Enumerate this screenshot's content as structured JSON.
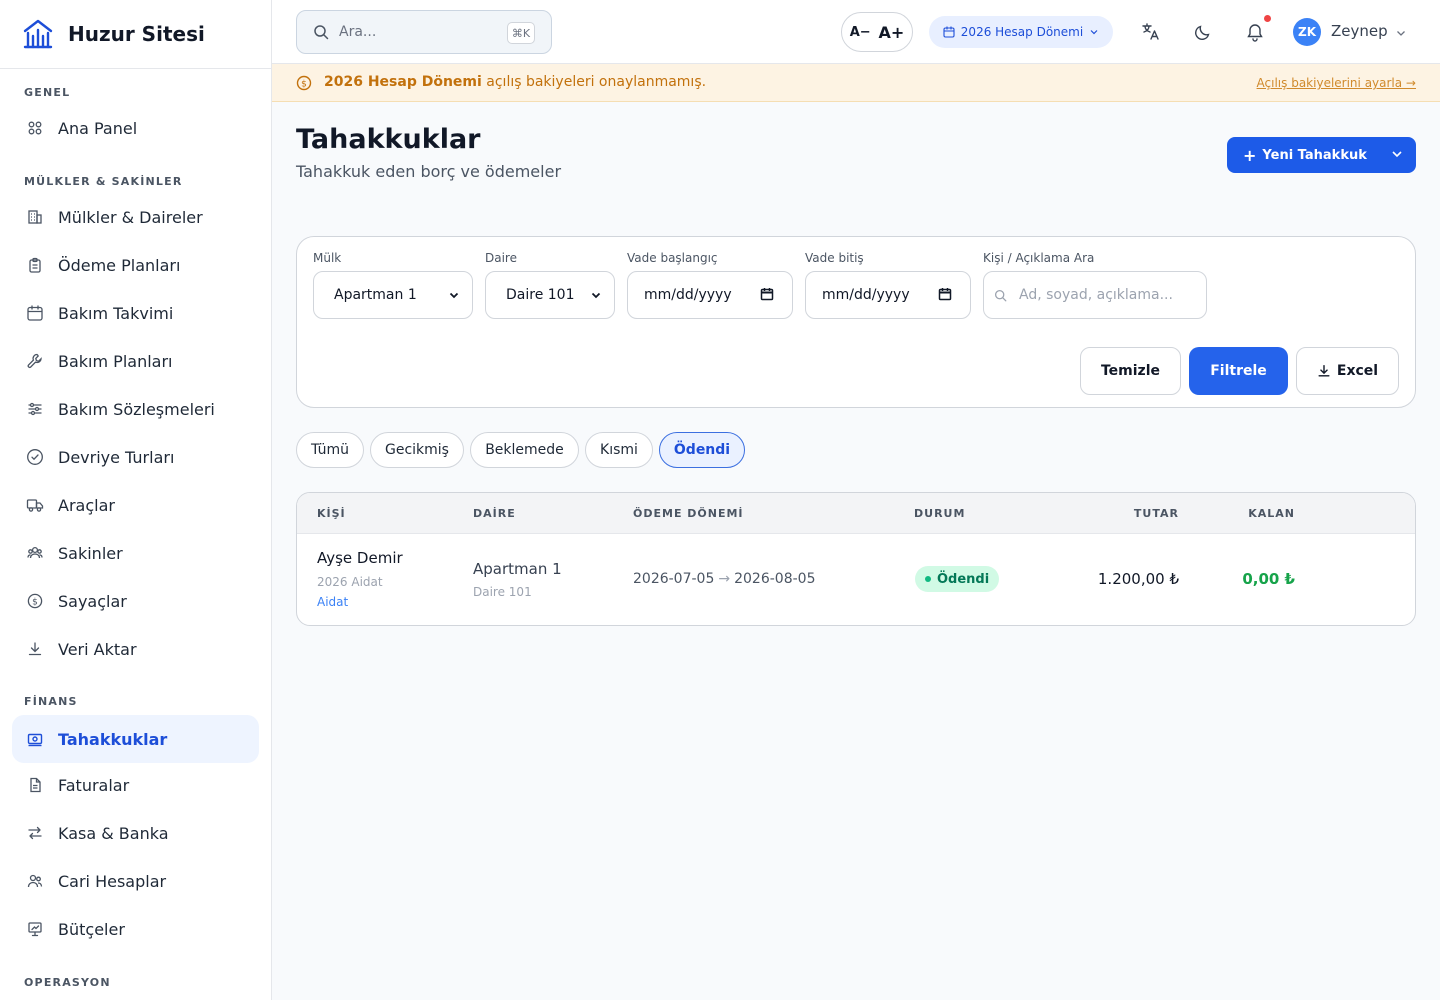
{
  "brand": {
    "name": "Huzur Sitesi"
  },
  "sidebar": {
    "sections": {
      "genel": "GENEL",
      "mulkler": "MÜLKLER & SAKİNLER",
      "finans": "FİNANS",
      "operasyon": "OPERASYON"
    },
    "items": {
      "ana_panel": "Ana Panel",
      "mulkler_daireler": "Mülkler & Daireler",
      "odeme_planlari": "Ödeme Planları",
      "bakim_takvimi": "Bakım Takvimi",
      "bakim_planlari": "Bakım Planları",
      "bakim_sozlesmeleri": "Bakım Sözleşmeleri",
      "devriye_turlari": "Devriye Turları",
      "araclar": "Araçlar",
      "sakinler": "Sakinler",
      "sayaclar": "Sayaçlar",
      "veri_aktar": "Veri Aktar",
      "tahakkuklar": "Tahakkuklar",
      "faturalar": "Faturalar",
      "kasa_banka": "Kasa & Banka",
      "cari_hesaplar": "Cari Hesaplar",
      "butceler": "Bütçeler"
    },
    "active": "tahakkuklar"
  },
  "topbar": {
    "search_placeholder": "Ara...",
    "search_shortcut": "⌘K",
    "font_decrease": "A−",
    "font_increase": "A+",
    "period": "2026 Hesap Dönemi",
    "avatar_initials": "ZK",
    "user_name": "Zeynep"
  },
  "banner": {
    "bold": "2026 Hesap Dönemi",
    "text": " açılış bakiyeleri onaylanmamış.",
    "link": "Açılış bakiyelerini ayarla →"
  },
  "page": {
    "title": "Tahakkuklar",
    "subtitle": "Tahakkuk eden borç ve ödemeler",
    "new_button": "Yeni Tahakkuk"
  },
  "filters": {
    "mulk_label": "Mülk",
    "mulk_value": "Apartman 1",
    "daire_label": "Daire",
    "daire_value": "Daire 101",
    "vade_bas_label": "Vade başlangıç",
    "vade_bas_value": "mm/dd/yyyy",
    "vade_bit_label": "Vade bitiş",
    "vade_bit_value": "mm/dd/yyyy",
    "search_label": "Kişi / Açıklama Ara",
    "search_placeholder": "Ad, soyad, açıklama...",
    "clear": "Temizle",
    "apply": "Filtrele",
    "excel": "Excel"
  },
  "tabs": [
    "Tümü",
    "Gecikmiş",
    "Beklemede",
    "Kısmi",
    "Ödendi"
  ],
  "active_tab": "Ödendi",
  "table": {
    "headers": {
      "kisi": "KİŞİ",
      "daire": "DAİRE",
      "donem": "ÖDEME DÖNEMİ",
      "durum": "DURUM",
      "tutar": "TUTAR",
      "kalan": "KALAN"
    },
    "rows": [
      {
        "person": "Ayşe Demir",
        "person_sub": "2026 Aidat",
        "type": "Aidat",
        "unit": "Apartman 1",
        "unit_sub": "Daire 101",
        "period_start": "2026-07-05",
        "period_end": "2026-08-05",
        "status": "Ödendi",
        "amount": "1.200,00 ₺",
        "remaining": "0,00 ₺"
      }
    ]
  },
  "colors": {
    "accent": "#2563eb",
    "active_bg": "#eef4ff",
    "warning_bg": "#fdf3e3",
    "warning_text": "#c2710c",
    "success": "#16a34a"
  }
}
